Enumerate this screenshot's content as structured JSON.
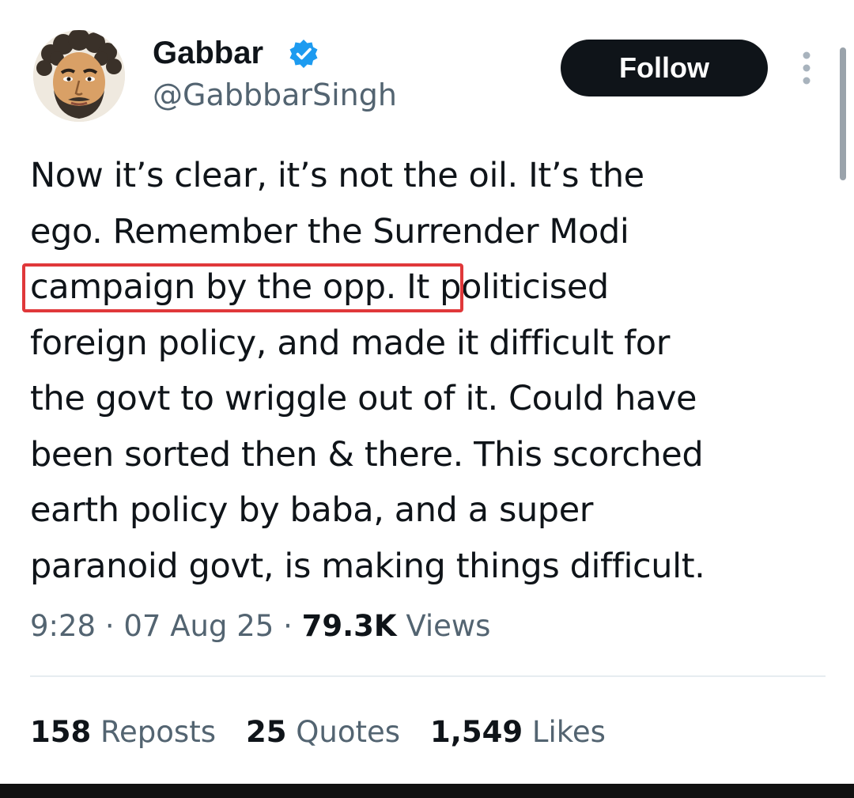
{
  "user": {
    "display_name": "Gabbar",
    "handle": "@GabbbarSingh",
    "verified_icon": "verified-badge-icon"
  },
  "follow_button": {
    "label": "Follow"
  },
  "tweet": {
    "lines": [
      "Now it’s clear, it’s not the oil. It’s the",
      "ego. Remember the Surrender Modi",
      "campaign by the opp. It politicised",
      "foreign policy, and made it difficult for",
      "the govt to wriggle out of it. Could have",
      "been sorted then & there. This scorched",
      "earth policy by baba, and a super",
      "paranoid govt, is making things difficult."
    ]
  },
  "meta": {
    "time": "9:28",
    "separator": " · ",
    "date": "07 Aug 25",
    "views_count": "79.3K",
    "views_label": " Views"
  },
  "stats": {
    "reposts_count": "158",
    "reposts_label": " Reposts",
    "quotes_count": "25",
    "quotes_label": " Quotes",
    "likes_count": "1,549",
    "likes_label": " Likes"
  },
  "colors": {
    "accent": "#1d9bf0",
    "highlight": "#e0383a",
    "text_primary": "#0f1419",
    "text_secondary": "#536471"
  }
}
